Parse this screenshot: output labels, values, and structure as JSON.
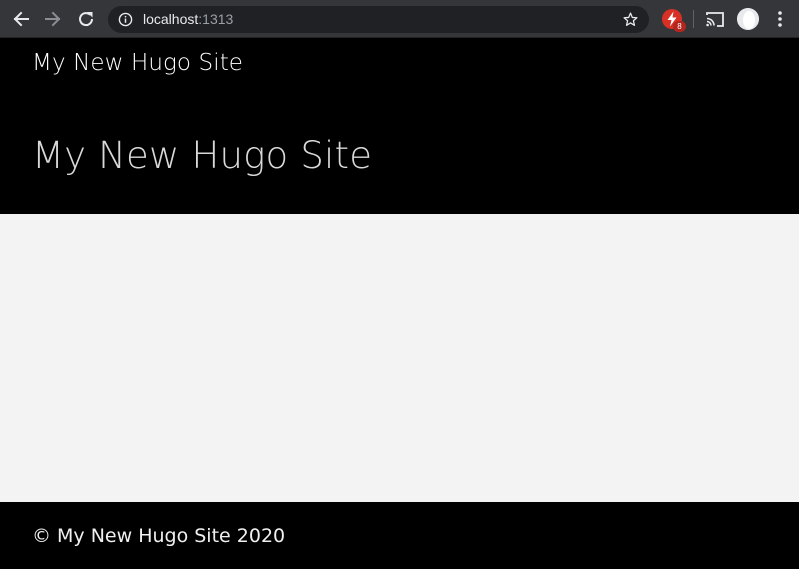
{
  "browser": {
    "url_host": "localhost",
    "url_port": ":1313",
    "extension_badge": "8",
    "colors": {
      "toolbar": "#35363a",
      "omnibox": "#202124",
      "extension": "#d93025"
    }
  },
  "site": {
    "brand": "My New Hugo Site",
    "hero_title": "My New Hugo Site",
    "footer_text": "© My New Hugo Site 2020",
    "colors": {
      "header_bg": "#000000",
      "main_bg": "#f3f3f3",
      "footer_bg": "#000000"
    }
  }
}
